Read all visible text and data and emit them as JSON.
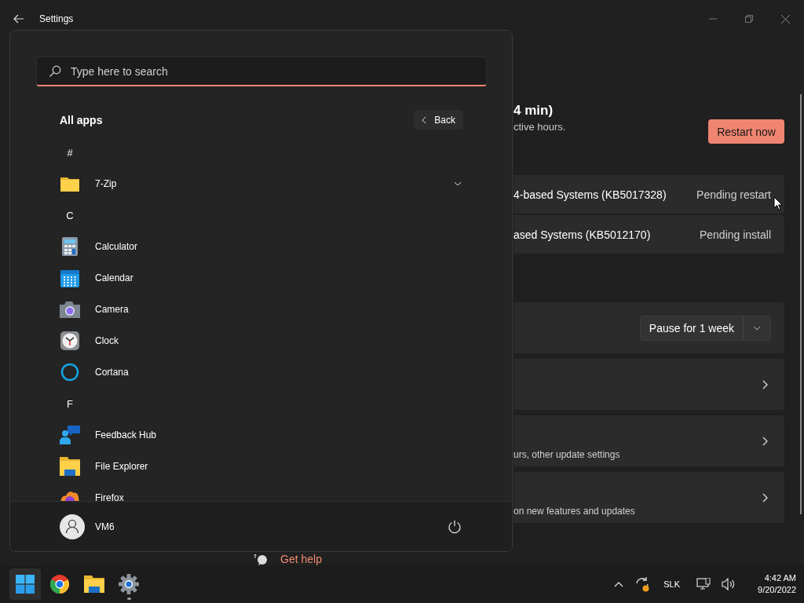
{
  "window": {
    "title": "Settings"
  },
  "update_panel": {
    "status_title": "4 min)",
    "status_subtitle": "ctive hours.",
    "restart_button": "Restart now",
    "updates": [
      {
        "name": "4-based Systems (KB5017328)",
        "status": "Pending restart"
      },
      {
        "name": "ased Systems (KB5012170)",
        "status": "Pending install"
      }
    ],
    "pause_button": "Pause for 1 week",
    "option_cards": [
      {
        "kind": "plain"
      },
      {
        "kind": "described",
        "description": "urs, other update settings"
      },
      {
        "kind": "described",
        "description": "on new features and updates"
      }
    ],
    "help_link": "Get help"
  },
  "start_menu": {
    "search": {
      "placeholder": "Type here to search"
    },
    "heading": "All apps",
    "back_button": "Back",
    "apps": [
      {
        "kind": "letter",
        "label": "#"
      },
      {
        "kind": "folder",
        "label": "7-Zip"
      },
      {
        "kind": "letter",
        "label": "C"
      },
      {
        "kind": "app",
        "label": "Calculator"
      },
      {
        "kind": "app",
        "label": "Calendar"
      },
      {
        "kind": "app",
        "label": "Camera"
      },
      {
        "kind": "app",
        "label": "Clock"
      },
      {
        "kind": "app",
        "label": "Cortana"
      },
      {
        "kind": "letter",
        "label": "F"
      },
      {
        "kind": "app",
        "label": "Feedback Hub"
      },
      {
        "kind": "app",
        "label": "File Explorer"
      },
      {
        "kind": "app",
        "label": "Firefox"
      }
    ],
    "user": {
      "name": "VM6"
    }
  },
  "taskbar": {
    "buttons": [
      {
        "selected": true,
        "running": false
      },
      {
        "selected": false,
        "running": false
      },
      {
        "selected": false,
        "running": false
      },
      {
        "selected": false,
        "running": true
      }
    ],
    "language": "SLK",
    "time": "4:42 AM",
    "date": "9/20/2022"
  }
}
